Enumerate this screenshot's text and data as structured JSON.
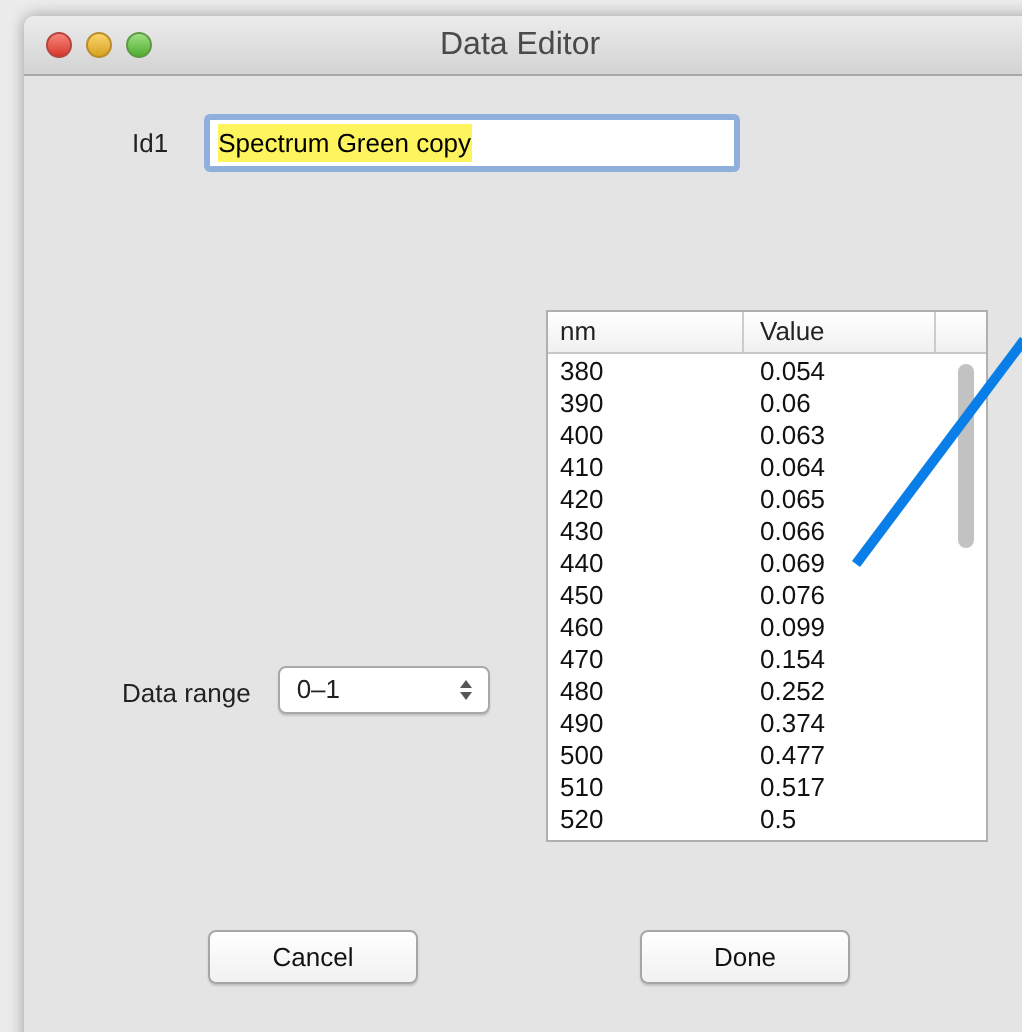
{
  "window": {
    "title": "Data Editor"
  },
  "name_field": {
    "label": "Id1",
    "value": "Spectrum Green copy",
    "text_selected": true
  },
  "data_range": {
    "label": "Data range",
    "value": "0–1"
  },
  "table": {
    "columns": [
      "nm",
      "Value"
    ],
    "rows": [
      [
        "380",
        "0.054"
      ],
      [
        "390",
        "0.06"
      ],
      [
        "400",
        "0.063"
      ],
      [
        "410",
        "0.064"
      ],
      [
        "420",
        "0.065"
      ],
      [
        "430",
        "0.066"
      ],
      [
        "440",
        "0.069"
      ],
      [
        "450",
        "0.076"
      ],
      [
        "460",
        "0.099"
      ],
      [
        "470",
        "0.154"
      ],
      [
        "480",
        "0.252"
      ],
      [
        "490",
        "0.374"
      ],
      [
        "500",
        "0.477"
      ],
      [
        "510",
        "0.517"
      ],
      [
        "520",
        "0.5"
      ]
    ]
  },
  "buttons": [
    "Cancel",
    "Done"
  ]
}
